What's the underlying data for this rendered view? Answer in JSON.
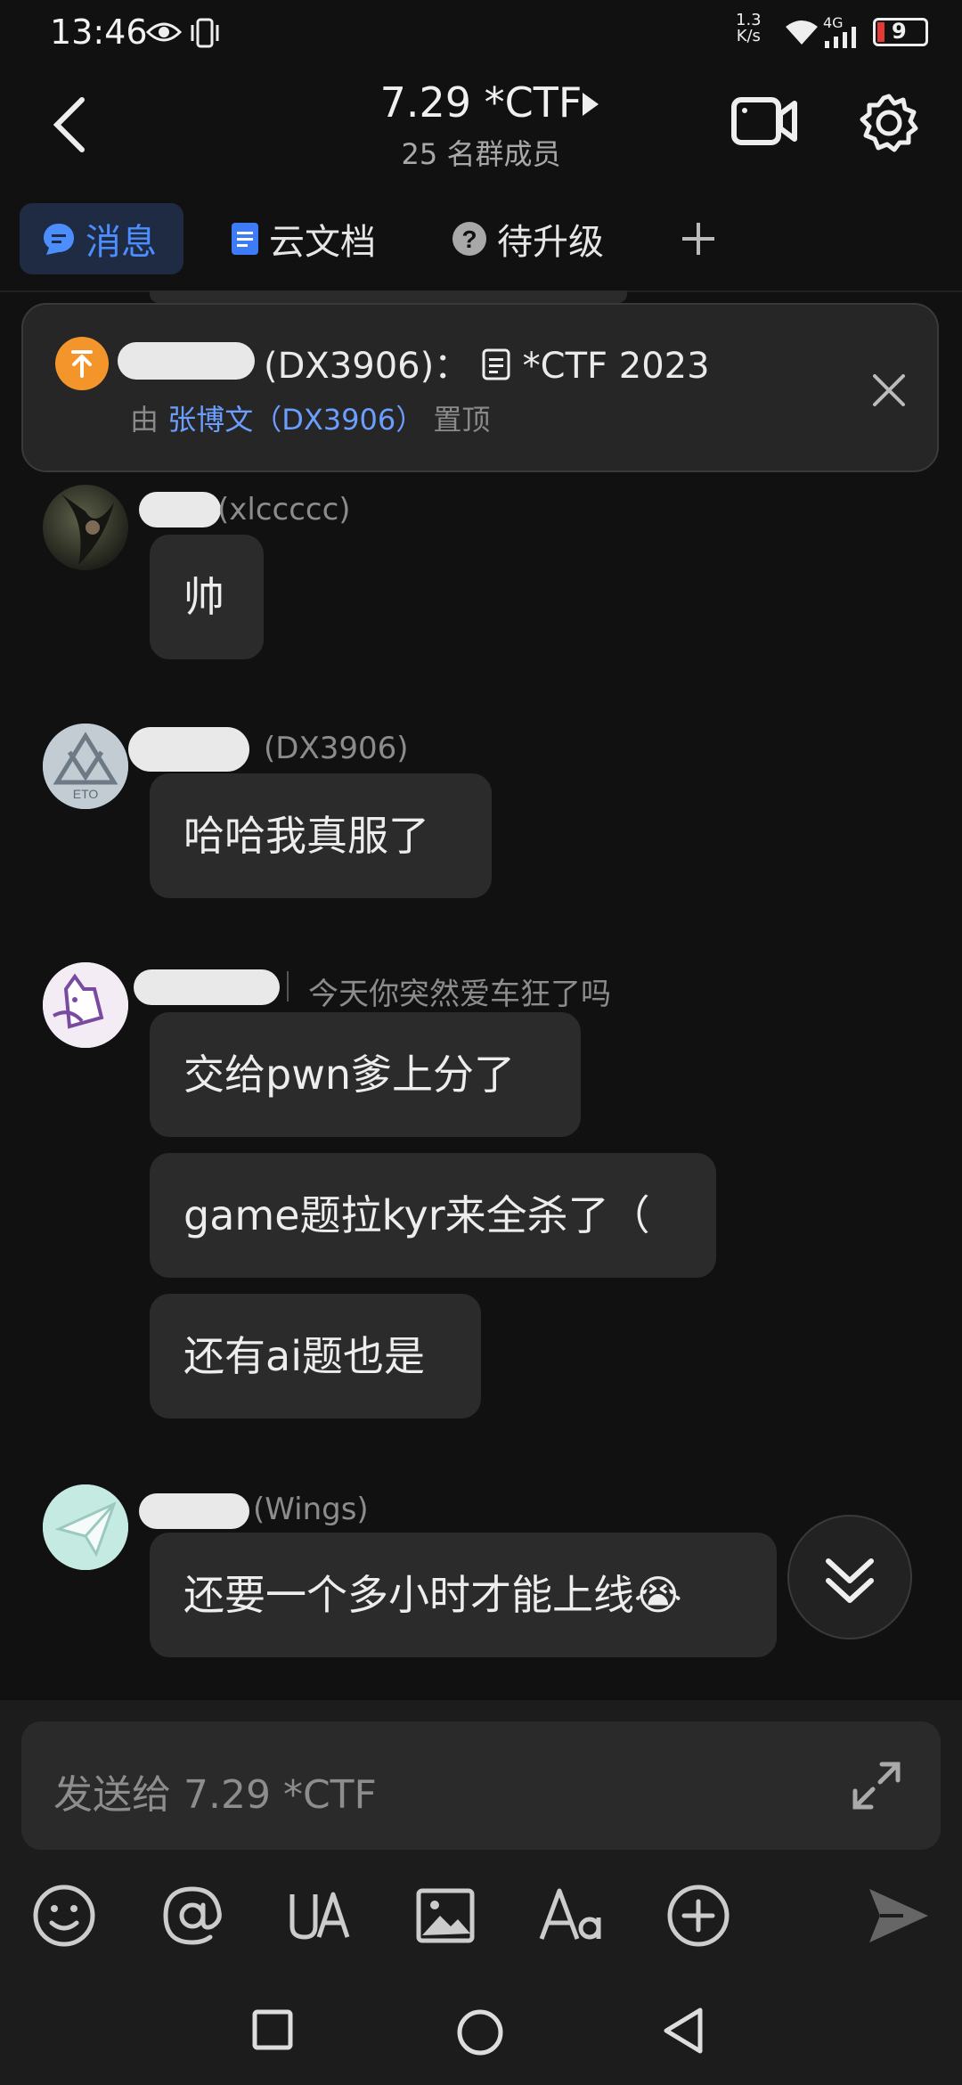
{
  "status_bar": {
    "time": "13:46",
    "speed": "1.3",
    "speed_unit": "K/s",
    "network": "4G",
    "battery": "9"
  },
  "header": {
    "title": "7.29 *CTF",
    "subtitle": "25 名群成员"
  },
  "tabs": [
    {
      "label": "消息",
      "icon": "chat-bubble-icon",
      "active": true
    },
    {
      "label": "云文档",
      "icon": "document-icon"
    },
    {
      "label": "待升级",
      "icon": "question-circle-icon"
    }
  ],
  "pinned": {
    "sender_id": "(DX3906)",
    "separator": "：",
    "doc_title": "*CTF 2023",
    "by_prefix": "由",
    "by_name": "张博文（DX3906）",
    "action": "置顶"
  },
  "messages": [
    {
      "sender": "(xlccccc)",
      "texts": [
        "帅"
      ]
    },
    {
      "sender": "(DX3906)",
      "texts": [
        "哈哈我真服了"
      ]
    },
    {
      "sender": "今天你突然爱车狂了吗",
      "texts": [
        "交给pwn爹上分了",
        "game题拉kyr来全杀了（",
        "还有ai题也是"
      ]
    },
    {
      "sender": "(Wings)",
      "texts": [
        "还要一个多小时才能上线",
        "😭"
      ]
    }
  ],
  "input": {
    "placeholder": "发送给 7.29 *CTF"
  },
  "colors": {
    "accent": "#4c8dff",
    "pin_orange": "#f3952a",
    "bubble": "#2b2b2b",
    "background": "#111111"
  }
}
